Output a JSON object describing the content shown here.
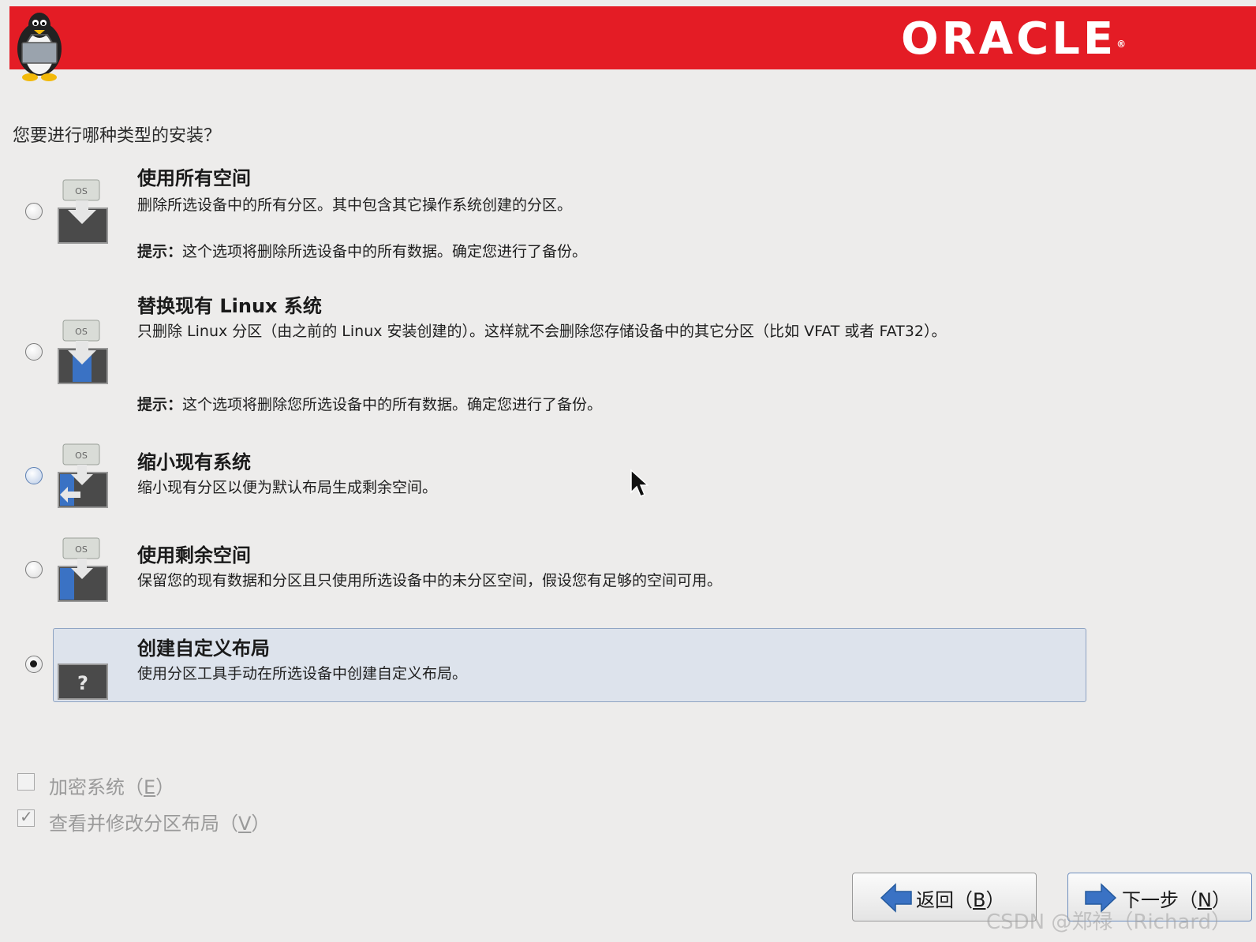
{
  "header": {
    "brand": "ORACLE",
    "brand_mark": "®"
  },
  "question": "您要进行哪种类型的安装？",
  "options": [
    {
      "title": "使用所有空间",
      "desc": "删除所选设备中的所有分区。其中包含其它操作系统创建的分区。",
      "tip_label": "提示：",
      "tip": "这个选项将删除所选设备中的所有数据。确定您进行了备份。",
      "icon": "os-disk-replace-all-icon",
      "selected": false
    },
    {
      "title": "替换现有 Linux 系统",
      "desc": "只删除 Linux 分区（由之前的 Linux 安装创建的）。这样就不会删除您存储设备中的其它分区（比如 VFAT 或者 FAT32）。",
      "tip_label": "提示：",
      "tip": "这个选项将删除您所选设备中的所有数据。确定您进行了备份。",
      "icon": "os-disk-replace-linux-icon",
      "selected": false
    },
    {
      "title": "缩小现有系统",
      "desc": "缩小现有分区以便为默认布局生成剩余空间。",
      "icon": "os-disk-shrink-icon",
      "selected": false
    },
    {
      "title": "使用剩余空间",
      "desc": "保留您的现有数据和分区且只使用所选设备中的未分区空间，假设您有足够的空间可用。",
      "icon": "os-disk-free-space-icon",
      "selected": false
    },
    {
      "title": "创建自定义布局",
      "desc": "使用分区工具手动在所选设备中创建自定义布局。",
      "icon": "question-disk-icon",
      "selected": true
    }
  ],
  "checkboxes": {
    "encrypt": {
      "label_pre": "加密系统（",
      "key": "E",
      "label_post": "）",
      "checked": false,
      "enabled": false
    },
    "review": {
      "label_pre": "查看并修改分区布局（",
      "key": "V",
      "label_post": "）",
      "checked": true,
      "enabled": false
    }
  },
  "buttons": {
    "back": {
      "label_pre": "返回（",
      "key": "B",
      "label_post": "）"
    },
    "next": {
      "label_pre": "下一步（",
      "key": "N",
      "label_post": "）"
    }
  },
  "watermark": "CSDN @郑禄（Richard）",
  "colors": {
    "banner": "#e41c25",
    "selection_bg": "#dde3ec",
    "arrow_blue": "#3a72c4"
  }
}
